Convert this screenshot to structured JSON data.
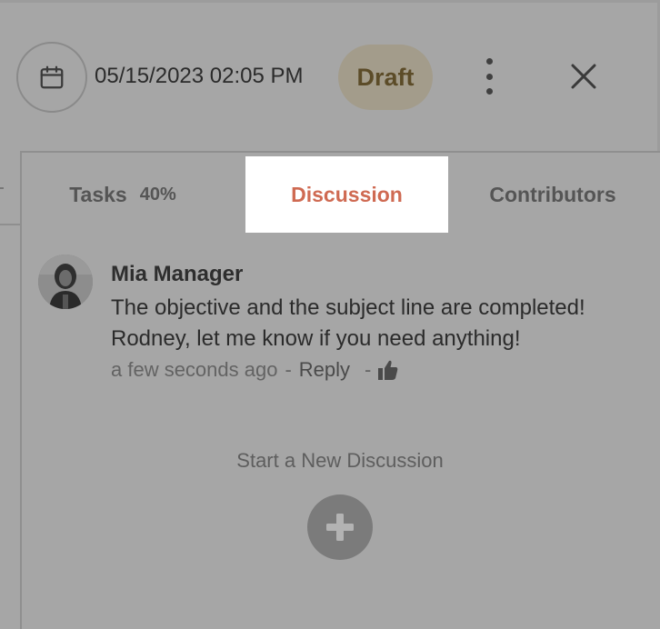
{
  "header": {
    "datetime": "05/15/2023 02:05 PM",
    "status": "Draft",
    "icons": {
      "calendar": "calendar-icon",
      "more": "more-vertical-icon",
      "close": "close-icon"
    }
  },
  "tabs": [
    {
      "label": "Tasks",
      "badge": "40%"
    },
    {
      "label": "Discussion",
      "active": true
    },
    {
      "label": "Contributors"
    }
  ],
  "discussion": {
    "comments": [
      {
        "author": "Mia Manager",
        "text": "The objective and the subject line are completed! Rodney, let me know if you need anything!",
        "time": "a few seconds ago",
        "separator": "-",
        "reply_label": "Reply",
        "like_icon": "thumbs-up-icon"
      }
    ],
    "start_label": "Start a New Discussion",
    "add_icon": "plus-icon"
  },
  "colors": {
    "overlay_background": "#a6a6a6",
    "active_tab_text": "#cf6a52",
    "draft_badge": "#a39c8b"
  }
}
